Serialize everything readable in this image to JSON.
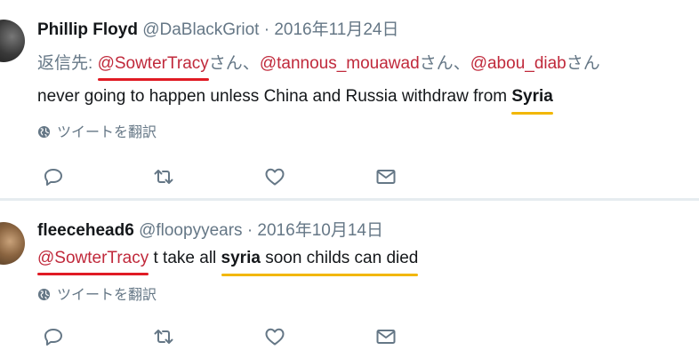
{
  "tweets": [
    {
      "name": "Phillip Floyd",
      "handle": "@DaBlackGriot",
      "separator": "·",
      "date": "2016年11月24日",
      "reply_prefix": "返信先:",
      "mentions": [
        "@SowterTracy",
        "@tannous_mouawad",
        "@abou_diab"
      ],
      "san": "さん",
      "comma": "、",
      "text_main": "never going to happen unless China and Russia withdraw from ",
      "text_bold": "Syria",
      "translate_label": "ツイートを翻訳"
    },
    {
      "name": "fleecehead6",
      "handle": "@floopyyears",
      "separator": "·",
      "date": "2016年10月14日",
      "mention": "@SowterTracy",
      "text_1": " t take all ",
      "text_bold": "syria",
      "text_2": " soon childs can died",
      "translate_label": "ツイートを翻訳"
    }
  ],
  "icons": {
    "translate": "globe-icon",
    "reply": "reply-icon",
    "retweet": "retweet-icon",
    "like": "heart-icon",
    "message": "envelope-icon"
  },
  "colors": {
    "mention": "#c0293b",
    "secondary_text": "#657786",
    "red_underline": "#e01b24",
    "yellow_underline": "#f2b705"
  }
}
